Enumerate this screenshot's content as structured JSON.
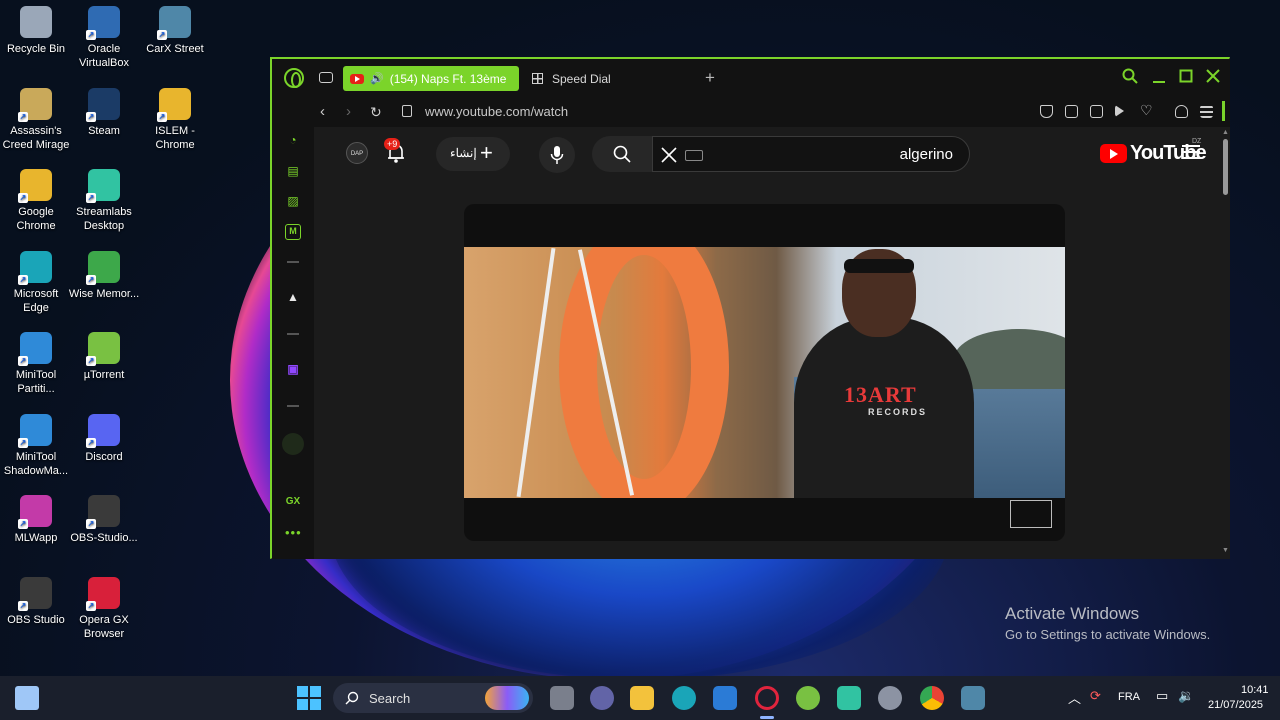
{
  "desktop": {
    "icons": [
      {
        "label": "Recycle Bin",
        "icon": "recycle-bin-icon",
        "color": "#9aa7b8"
      },
      {
        "label": "Oracle VirtualBox",
        "icon": "virtualbox-icon",
        "color": "#2f6bb3"
      },
      {
        "label": "CarX Street",
        "icon": "game-icon",
        "color": "#4f87a8"
      },
      {
        "label": "Assassin's Creed Mirage",
        "icon": "game-icon",
        "color": "#c9a95a"
      },
      {
        "label": "Steam",
        "icon": "steam-icon",
        "color": "#1b3b66"
      },
      {
        "label": "ISLEM - Chrome",
        "icon": "chrome-icon",
        "color": "#e8b52d"
      },
      {
        "label": "Google Chrome",
        "icon": "chrome-icon",
        "color": "#e8b52d"
      },
      {
        "label": "Streamlabs Desktop",
        "icon": "streamlabs-icon",
        "color": "#31c3a2"
      },
      {
        "label": "Microsoft Edge",
        "icon": "edge-icon",
        "color": "#1aa5b8"
      },
      {
        "label": "Wise Memor...",
        "icon": "wise-memory-icon",
        "color": "#3da84a"
      },
      {
        "label": "MiniTool Partiti...",
        "icon": "minitool-icon",
        "color": "#2f8ad8"
      },
      {
        "label": "µTorrent",
        "icon": "utorrent-icon",
        "color": "#79c142"
      },
      {
        "label": "MiniTool ShadowMa...",
        "icon": "minitool-icon",
        "color": "#2f8ad8"
      },
      {
        "label": "Discord",
        "icon": "discord-icon",
        "color": "#5865f2"
      },
      {
        "label": "MLWapp",
        "icon": "app-icon",
        "color": "#c33aa8"
      },
      {
        "label": "OBS-Studio...",
        "icon": "obs-icon",
        "color": "#3a3a3a"
      },
      {
        "label": "OBS Studio",
        "icon": "obs-icon",
        "color": "#3a3a3a"
      },
      {
        "label": "Opera GX Browser",
        "icon": "opera-gx-icon",
        "color": "#d8203a"
      }
    ]
  },
  "browser": {
    "accent": "#7bd42a",
    "tabs": [
      {
        "label": "(154) Naps Ft. 13ème",
        "active": true
      },
      {
        "label": "Speed Dial",
        "active": false
      }
    ],
    "url": "www.youtube.com/watch",
    "sidebar_extra": "GX"
  },
  "youtube": {
    "badge": "+9",
    "create_label": "إنشاء",
    "search_value": "algerino",
    "logo": "YouTube",
    "country": "DZ",
    "video_shirt_text": "13ART",
    "video_shirt_sub": "RECORDS"
  },
  "activation": {
    "title": "Activate Windows",
    "subtitle": "Go to Settings to activate Windows."
  },
  "taskbar": {
    "search_label": "Search",
    "language": "FRA",
    "time": "10:41",
    "date": "21/07/2025"
  }
}
